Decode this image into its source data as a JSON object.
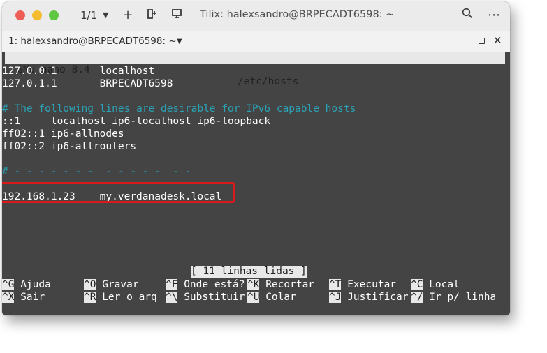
{
  "titlebar": {
    "session_count": "1/1",
    "title": "Tilix: halexsandro@BRPECADT6598: ~",
    "icons": [
      "chevron-down-icon",
      "plus-icon",
      "split-icon",
      "add-terminal-icon",
      "search-icon",
      "menu-icon"
    ]
  },
  "tab": {
    "title": "1: halexsandro@BRPECADT6598: ~"
  },
  "nano": {
    "version": "GNU nano 8.4",
    "filename": "/etc/hosts",
    "lines": [
      "127.0.0.1       localhost",
      "127.0.1.1       BRPECADT6598",
      "",
      "# The following lines are desirable for IPv6 capable hosts",
      "::1     localhost ip6-localhost ip6-loopback",
      "ff02::1 ip6-allnodes",
      "ff02::2 ip6-allrouters",
      "",
      "# - - - - - - -  - - - - -  - -",
      "",
      "192.168.1.23    my.verdanadesk.local"
    ],
    "status": "[ 11 linhas lidas ]",
    "shortcuts_row1": [
      {
        "key": "^G",
        "label": " Ajuda"
      },
      {
        "key": "^O",
        "label": " Gravar"
      },
      {
        "key": "^F",
        "label": " Onde está?"
      },
      {
        "key": "^K",
        "label": " Recortar"
      },
      {
        "key": "^T",
        "label": " Executar"
      },
      {
        "key": "^C",
        "label": " Local"
      }
    ],
    "shortcuts_row2": [
      {
        "key": "^X",
        "label": " Sair"
      },
      {
        "key": "^R",
        "label": " Ler o arq"
      },
      {
        "key": "^\\",
        "label": " Substituir"
      },
      {
        "key": "^U",
        "label": " Colar"
      },
      {
        "key": "^J",
        "label": " Justificar"
      },
      {
        "key": "^/",
        "label": " Ir p/ linha"
      }
    ]
  },
  "colors": {
    "terminal_bg": "#444444",
    "comment": "#2aa3b6",
    "highlight": "#d81a1a"
  }
}
